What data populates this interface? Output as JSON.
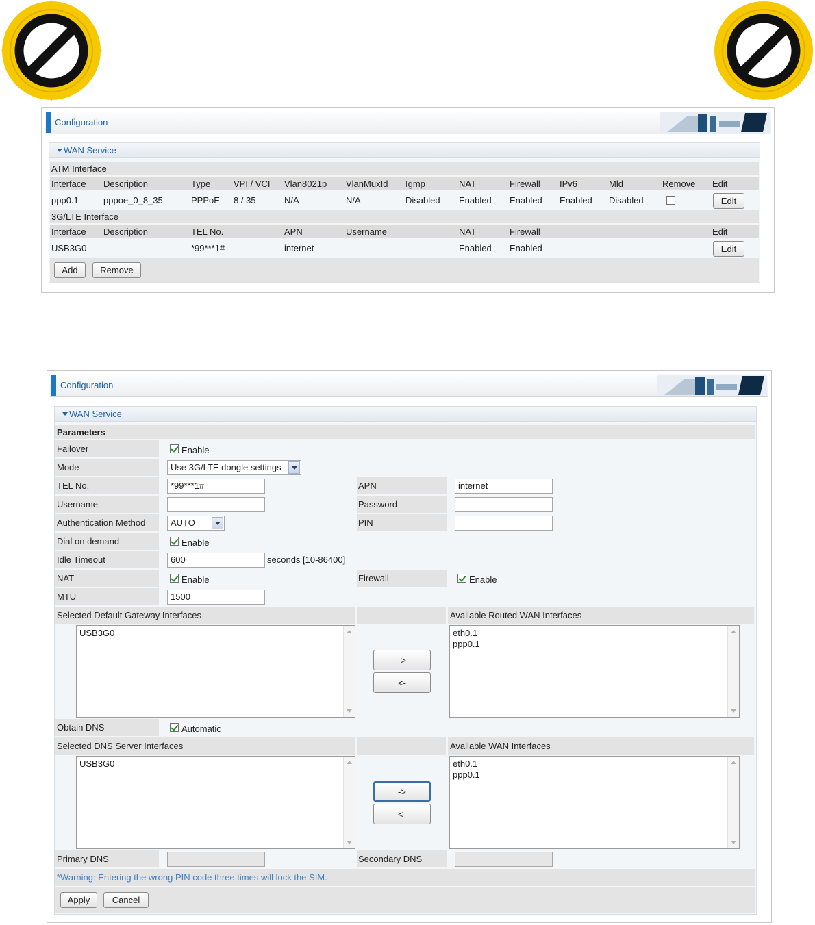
{
  "badges": {
    "icon": "prohibited-sign-icon",
    "color": "#f5c800"
  },
  "panel1": {
    "header_title": "Configuration",
    "section_title": "WAN Service",
    "atm": {
      "heading": "ATM Interface",
      "columns": [
        "Interface",
        "Description",
        "Type",
        "VPI / VCI",
        "Vlan8021p",
        "VlanMuxId",
        "Igmp",
        "NAT",
        "Firewall",
        "IPv6",
        "Mld",
        "Remove",
        "Edit"
      ],
      "row": {
        "interface": "ppp0.1",
        "description": "pppoe_0_8_35",
        "type": "PPPoE",
        "vpi_vci": "8 / 35",
        "vlan8021p": "N/A",
        "vlanmuxid": "N/A",
        "igmp": "Disabled",
        "nat": "Enabled",
        "firewall": "Enabled",
        "ipv6": "Enabled",
        "mld": "Disabled",
        "remove_checked": false,
        "edit_label": "Edit"
      }
    },
    "lte": {
      "heading": "3G/LTE Interface",
      "columns": [
        "Interface",
        "Description",
        "TEL No.",
        "APN",
        "Username",
        "NAT",
        "Firewall",
        "Edit"
      ],
      "row": {
        "interface": "USB3G0",
        "description": "",
        "tel_no": "*99***1#",
        "apn": "internet",
        "username": "",
        "nat": "Enabled",
        "firewall": "Enabled",
        "edit_label": "Edit"
      }
    },
    "add_label": "Add",
    "remove_label": "Remove"
  },
  "panel2": {
    "header_title": "Configuration",
    "section_title": "WAN Service",
    "parameters_heading": "Parameters",
    "failover": {
      "label": "Failover",
      "checked": true,
      "text": "Enable"
    },
    "mode": {
      "label": "Mode",
      "value": "Use 3G/LTE dongle settings"
    },
    "tel_no": {
      "label": "TEL No.",
      "value": "*99***1#"
    },
    "apn": {
      "label": "APN",
      "value": "internet"
    },
    "username": {
      "label": "Username",
      "value": ""
    },
    "password": {
      "label": "Password",
      "value": ""
    },
    "auth_method": {
      "label": "Authentication Method",
      "value": "AUTO"
    },
    "pin": {
      "label": "PIN",
      "value": ""
    },
    "dial_on_demand": {
      "label": "Dial on demand",
      "checked": true,
      "text": "Enable"
    },
    "idle_timeout": {
      "label": "Idle Timeout",
      "value": "600",
      "suffix": "seconds  [10-86400]"
    },
    "nat": {
      "label": "NAT",
      "checked": true,
      "text": "Enable"
    },
    "firewall": {
      "label": "Firewall",
      "checked": true,
      "text": "Enable"
    },
    "mtu": {
      "label": "MTU",
      "value": "1500"
    },
    "gateway": {
      "selected_label": "Selected Default Gateway Interfaces",
      "available_label": "Available Routed WAN Interfaces",
      "selected_items": [
        "USB3G0"
      ],
      "available_items": [
        "eth0.1",
        "ppp0.1"
      ],
      "move_right": "->",
      "move_left": "<-"
    },
    "obtain_dns": {
      "label": "Obtain DNS",
      "checked": true,
      "text": "Automatic"
    },
    "dns": {
      "selected_label": "Selected DNS Server Interfaces",
      "available_label": "Available WAN Interfaces",
      "selected_items": [
        "USB3G0"
      ],
      "available_items": [
        "eth0.1",
        "ppp0.1"
      ],
      "move_right": "->",
      "move_left": "<-"
    },
    "primary_dns": {
      "label": "Primary DNS",
      "value": ""
    },
    "secondary_dns": {
      "label": "Secondary DNS",
      "value": ""
    },
    "warning": "*Warning: Entering the wrong PIN code three times will lock the SIM.",
    "apply_label": "Apply",
    "cancel_label": "Cancel"
  }
}
